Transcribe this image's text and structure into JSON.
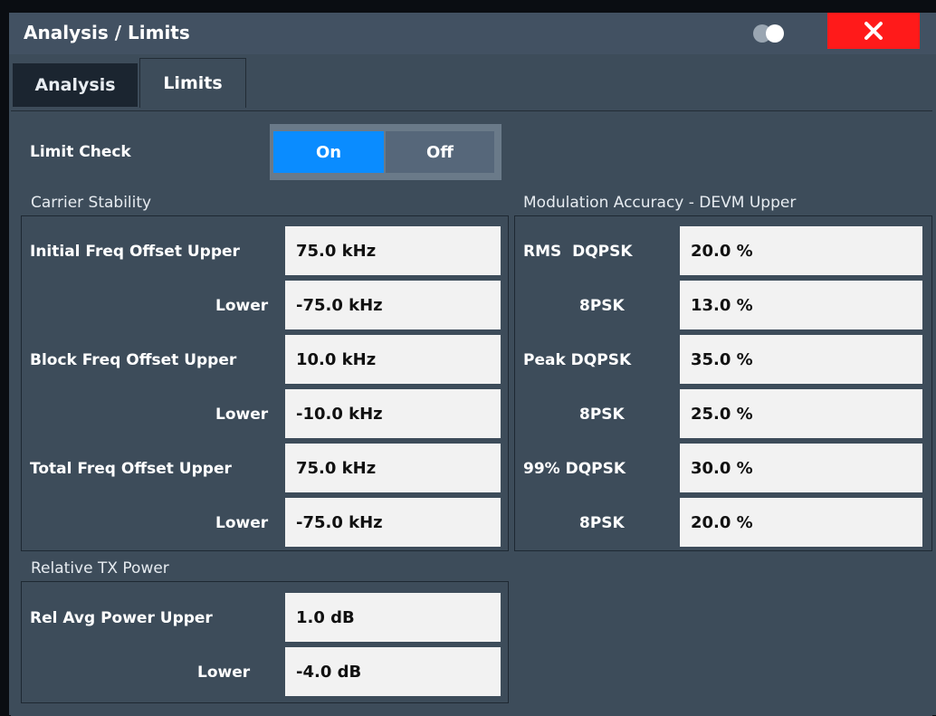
{
  "window": {
    "title": "Analysis / Limits"
  },
  "tabs": [
    {
      "label": "Analysis",
      "active": false
    },
    {
      "label": "Limits",
      "active": true
    }
  ],
  "limit_check": {
    "label": "Limit Check",
    "on": "On",
    "off": "Off",
    "selected": "On"
  },
  "carrier_stability": {
    "title": "Carrier Stability",
    "rows": [
      {
        "label": "Initial Freq Offset Upper",
        "value": "75.0 kHz"
      },
      {
        "label": "Lower",
        "value": "-75.0 kHz"
      },
      {
        "label": "Block Freq Offset Upper",
        "value": "10.0 kHz"
      },
      {
        "label": "Lower",
        "value": "-10.0 kHz"
      },
      {
        "label": "Total Freq Offset Upper",
        "value": "75.0 kHz"
      },
      {
        "label": "Lower",
        "value": "-75.0 kHz"
      }
    ]
  },
  "modulation_accuracy": {
    "title": "Modulation Accuracy - DEVM Upper",
    "rows": [
      {
        "label": "RMS  DQPSK",
        "value": "20.0 %"
      },
      {
        "label": "8PSK",
        "value": "13.0 %"
      },
      {
        "label": "Peak DQPSK",
        "value": "35.0 %"
      },
      {
        "label": "8PSK",
        "value": "25.0 %"
      },
      {
        "label": "99% DQPSK",
        "value": "30.0 %"
      },
      {
        "label": "8PSK",
        "value": "20.0 %"
      }
    ]
  },
  "relative_tx_power": {
    "title": "Relative TX Power",
    "rows": [
      {
        "label": "Rel Avg Power Upper",
        "value": "1.0 dB"
      },
      {
        "label": "Lower",
        "value": "-4.0 dB"
      }
    ]
  },
  "colors": {
    "accent": "#0a8cff",
    "close": "#ff1a1a",
    "panel": "#3d4c5a"
  },
  "icons": {
    "toggle": "toggle-icon",
    "close": "close-icon"
  }
}
